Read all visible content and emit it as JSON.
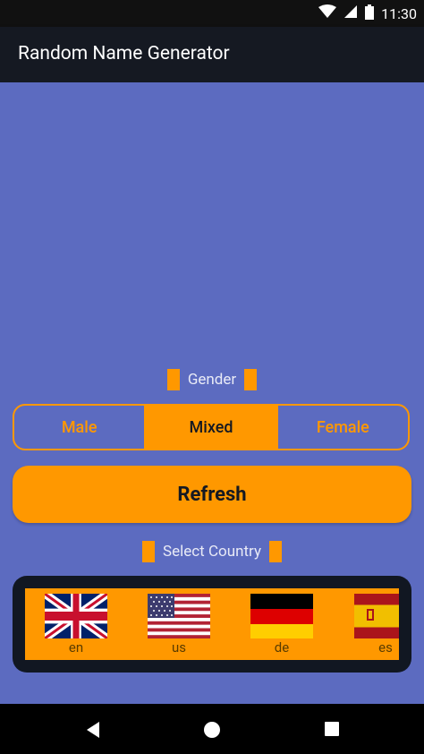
{
  "status_bar": {
    "time": "11:30"
  },
  "app_bar": {
    "title": "Random Name Generator"
  },
  "gender": {
    "label": "Gender",
    "options": [
      "Male",
      "Mixed",
      "Female"
    ],
    "selected": "Mixed"
  },
  "refresh_label": "Refresh",
  "country": {
    "label": "Select Country",
    "items": [
      {
        "code": "en",
        "flag": "uk-flag-icon"
      },
      {
        "code": "us",
        "flag": "us-flag-icon"
      },
      {
        "code": "de",
        "flag": "germany-flag-icon"
      },
      {
        "code": "es",
        "flag": "spain-flag-icon"
      }
    ]
  },
  "colors": {
    "primary": "#5c6bc0",
    "accent": "#ff9800",
    "appbar": "#151922"
  }
}
